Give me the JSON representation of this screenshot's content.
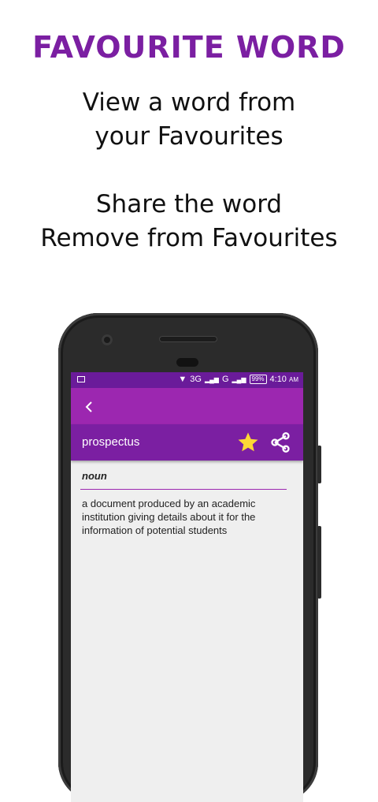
{
  "promo": {
    "title": "FAVOURITE WORD",
    "line1": "View a word from",
    "line2": "your Favourites",
    "line3": "Share the word",
    "line4": "Remove from Favourites"
  },
  "statusbar": {
    "network1": "3G",
    "network2": "G",
    "battery": "99%",
    "time": "4:10",
    "ampm": "AM"
  },
  "appbar": {
    "back_icon": "back-arrow-icon"
  },
  "word": {
    "title": "prospectus",
    "star_icon": "star-icon",
    "share_icon": "share-icon",
    "part_of_speech": "noun",
    "definition": "a document produced by an academic institution giving details about it for the information of potential students"
  },
  "colors": {
    "accent": "#9c27b0",
    "accent_dark": "#7b1fa2",
    "statusbar": "#6a1b9a",
    "star": "#fdd835"
  }
}
